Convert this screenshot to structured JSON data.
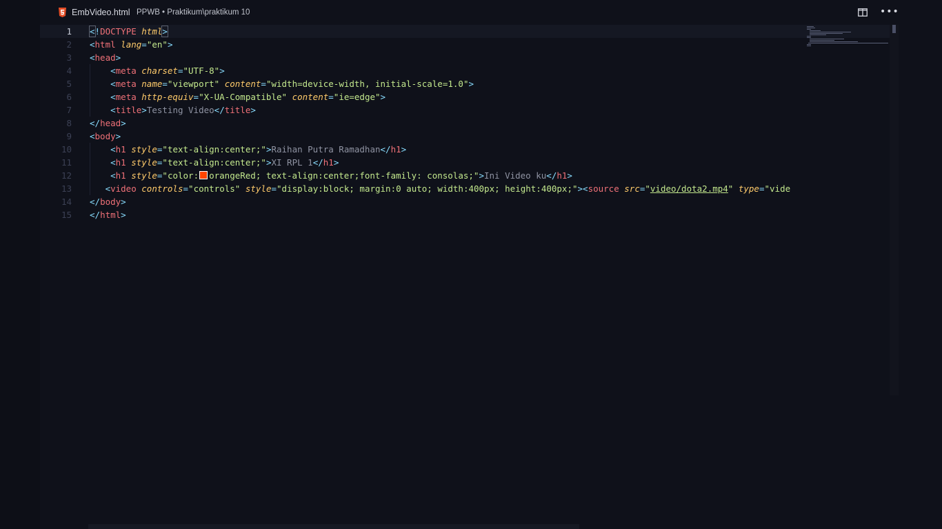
{
  "titlebar": {
    "file_name": "EmbVideo.html",
    "path": "PPWB • Praktikum\\praktikum 10",
    "file_icon": "html5-icon",
    "split_icon": "split-editor-icon",
    "more_icon": "more-actions-icon"
  },
  "colors": {
    "background": "#0f111a",
    "tag": "#f07178",
    "attribute": "#ffcb6b",
    "string": "#c3e88d",
    "punctuation": "#89ddff",
    "text": "#8f93a2",
    "swatch": "#ff4500"
  },
  "editor": {
    "current_line": 1,
    "lines": [
      {
        "num": "1",
        "code": "<!DOCTYPE html>"
      },
      {
        "num": "2",
        "code": "<html lang=\"en\">"
      },
      {
        "num": "3",
        "code": "<head>"
      },
      {
        "num": "4",
        "code": "    <meta charset=\"UTF-8\">"
      },
      {
        "num": "5",
        "code": "    <meta name=\"viewport\" content=\"width=device-width, initial-scale=1.0\">"
      },
      {
        "num": "6",
        "code": "    <meta http-equiv=\"X-UA-Compatible\" content=\"ie=edge\">"
      },
      {
        "num": "7",
        "code": "    <title>Testing Video</title>"
      },
      {
        "num": "8",
        "code": "</head>"
      },
      {
        "num": "9",
        "code": "<body>"
      },
      {
        "num": "10",
        "code": "    <h1 style=\"text-align:center;\">Raihan Putra Ramadhan</h1>"
      },
      {
        "num": "11",
        "code": "    <h1 style=\"text-align:center;\">XI RPL 1</h1>"
      },
      {
        "num": "12",
        "code": "    <h1 style=\"color:orangeRed; text-align:center;font-family: consolas;\">Ini Video ku</h1>"
      },
      {
        "num": "13",
        "code": "   <video controls=\"controls\" style=\"display:block; margin:0 auto; width:400px; height:400px;\"><source src=\"video/dota2.mp4\" type=\"vide"
      },
      {
        "num": "14",
        "code": "</body>"
      },
      {
        "num": "15",
        "code": "</html>"
      }
    ]
  }
}
